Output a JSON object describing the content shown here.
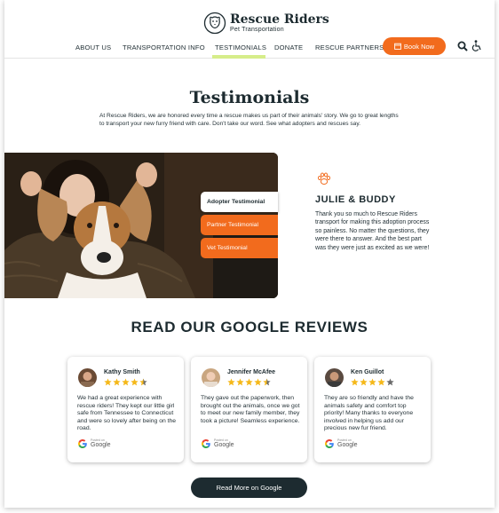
{
  "brand": {
    "name": "Rescue Riders",
    "tagline": "Pet Transportation"
  },
  "nav": {
    "items": [
      "ABOUT US",
      "TRANSPORTATION INFO",
      "TESTIMONIALS",
      "DONATE",
      "RESCUE PARTNERS"
    ],
    "active": "TESTIMONIALS",
    "book_label": "Book Now"
  },
  "testimonials": {
    "title": "Testimonials",
    "intro": "At Rescue Riders, we are honored every time a rescue makes us part of their animals' story. We go to great lengths to transport your new furry friend with care. Don't take our word. See what adopters and rescues say.",
    "tabs": [
      "Adopter Testimonial",
      "Partner Testimonial",
      "Vet Testimonial"
    ],
    "active_tab": "Adopter Testimonial",
    "quote": {
      "name": "JULIE & BUDDY",
      "text": "Thank you so much to Rescue Riders transport for making this adoption process so painless. No matter the questions, they were there to answer. And the best part was they were just as excited as we were!"
    }
  },
  "reviews": {
    "title": "READ OUR GOOGLE REVIEWS",
    "items": [
      {
        "name": "Kathy Smith",
        "rating": 4.5,
        "text": "We had a great experience with rescue riders! They kept our little girl safe from Tennessee to Connecticut and were so lovely after being on the road.",
        "posted_on": "Posted on",
        "source": "Google"
      },
      {
        "name": "Jennifer McAfee",
        "rating": 4.5,
        "text": "They gave out the paperwork, then brought out the animals, once we got to meet our new family member, they took a picture! Seamless experience.",
        "posted_on": "Posted on",
        "source": "Google"
      },
      {
        "name": "Ken Guillot",
        "rating": 4,
        "text": "They are so friendly and have the animals safety and comfort top priority! Many thanks to everyone involved in helping us add our precious new fur friend.",
        "posted_on": "Posted on",
        "source": "Google"
      }
    ],
    "more_label": "Read More on Google"
  },
  "colors": {
    "accent": "#f26b1d",
    "dark": "#1d2b30",
    "highlight": "#d6ed8a",
    "star": "#f5b819"
  },
  "icons": [
    "calendar-icon",
    "search-icon",
    "accessibility-icon",
    "paw-icon",
    "star-icon",
    "google-icon"
  ]
}
